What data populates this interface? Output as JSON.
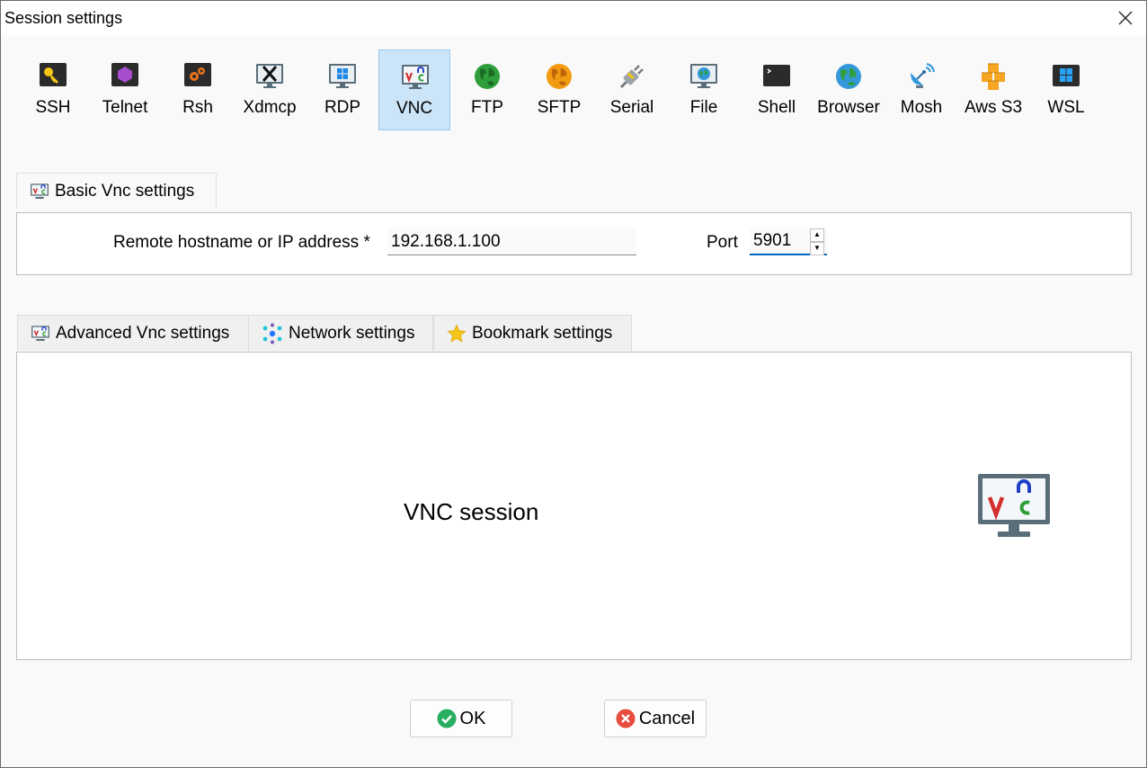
{
  "window": {
    "title": "Session settings"
  },
  "toolbar": {
    "items": [
      {
        "label": "SSH",
        "icon": "key-icon"
      },
      {
        "label": "Telnet",
        "icon": "telnet-icon"
      },
      {
        "label": "Rsh",
        "icon": "rsh-icon"
      },
      {
        "label": "Xdmcp",
        "icon": "x-monitor-icon"
      },
      {
        "label": "RDP",
        "icon": "windows-monitor-icon"
      },
      {
        "label": "VNC",
        "icon": "vnc-monitor-icon"
      },
      {
        "label": "FTP",
        "icon": "green-globe-icon"
      },
      {
        "label": "SFTP",
        "icon": "orange-globe-icon"
      },
      {
        "label": "Serial",
        "icon": "serial-plug-icon"
      },
      {
        "label": "File",
        "icon": "monitor-globe-icon"
      },
      {
        "label": "Shell",
        "icon": "terminal-icon"
      },
      {
        "label": "Browser",
        "icon": "globe-icon"
      },
      {
        "label": "Mosh",
        "icon": "satellite-dish-icon"
      },
      {
        "label": "Aws S3",
        "icon": "cubes-icon"
      },
      {
        "label": "WSL",
        "icon": "windows-icon"
      }
    ],
    "active": "VNC"
  },
  "basic": {
    "tab_label": "Basic Vnc settings",
    "host_label": "Remote hostname or IP address *",
    "host_value": "192.168.1.100",
    "port_label": "Port",
    "port_value": "5901"
  },
  "advanced_tabs": [
    {
      "label": "Advanced Vnc settings",
      "icon": "vnc-monitor-icon"
    },
    {
      "label": "Network settings",
      "icon": "network-icon"
    },
    {
      "label": "Bookmark settings",
      "icon": "star-icon"
    }
  ],
  "session": {
    "label": "VNC session"
  },
  "buttons": {
    "ok": "OK",
    "cancel": "Cancel"
  },
  "colors": {
    "accent": "#0067c0",
    "active_tab": "#cce4f7",
    "ok": "#27ae60",
    "cancel": "#e74c3c"
  }
}
